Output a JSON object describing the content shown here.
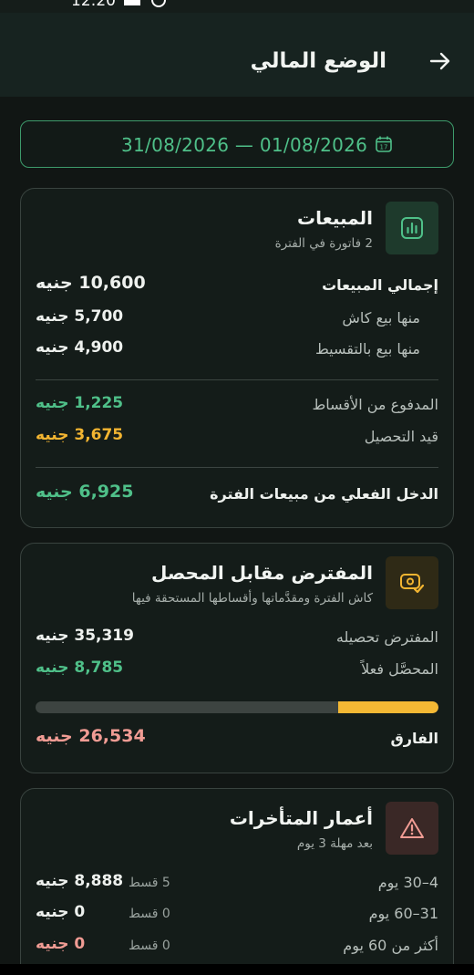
{
  "status": {
    "time": "12:20"
  },
  "header": {
    "title": "الوضع المالي",
    "back_icon": "arrow-right-icon"
  },
  "date_range": {
    "text": "31/08/2026 — 01/08/2026",
    "icon": "calendar-icon"
  },
  "sales": {
    "title": "المبيعات",
    "subtitle": "2 فاتورة في الفترة",
    "icon": "bar-chart-icon",
    "rows": [
      {
        "label": "إجمالي المبيعات",
        "amount": "10,600 جنيه"
      },
      {
        "label": "منها بيع كاش",
        "amount": "5,700 جنيه"
      },
      {
        "label": "منها بيع بالتقسيط",
        "amount": "4,900 جنيه"
      },
      {
        "label": "المدفوع من الأقساط",
        "amount": "1,225 جنيه"
      },
      {
        "label": "قيد التحصيل",
        "amount": "3,675 جنيه"
      },
      {
        "label": "الدخل الفعلي من مبيعات الفترة",
        "amount": "6,925 جنيه"
      }
    ]
  },
  "collection": {
    "title": "المفترض مقابل المحصل",
    "subtitle": "كاش الفترة ومقدَّماتها وأقساطها المستحقة فيها",
    "icon": "cash-check-icon",
    "rows": [
      {
        "label": "المفترض تحصيله",
        "amount": "35,319 جنيه"
      },
      {
        "label": "المحصَّل فعلاً",
        "amount": "8,785 جنيه"
      }
    ],
    "progress_fraction": 0.249,
    "difference": {
      "label": "الفارق",
      "amount": "26,534 جنيه"
    }
  },
  "aging": {
    "title": "أعمار المتأخرات",
    "subtitle": "بعد مهلة 3 يوم",
    "icon": "warning-icon",
    "rows": [
      {
        "label": "4–30 يوم",
        "count": "5 قسط",
        "amount": "8,888 جنيه"
      },
      {
        "label": "31–60 يوم",
        "count": "0 قسط",
        "amount": "0 جنيه"
      },
      {
        "label": "أكثر من 60 يوم",
        "count": "0 قسط",
        "amount": "0 جنيه"
      }
    ]
  },
  "colors": {
    "green": "#4fc089",
    "amber": "#f3b531",
    "pink": "#f19c94",
    "background": "#111614"
  }
}
